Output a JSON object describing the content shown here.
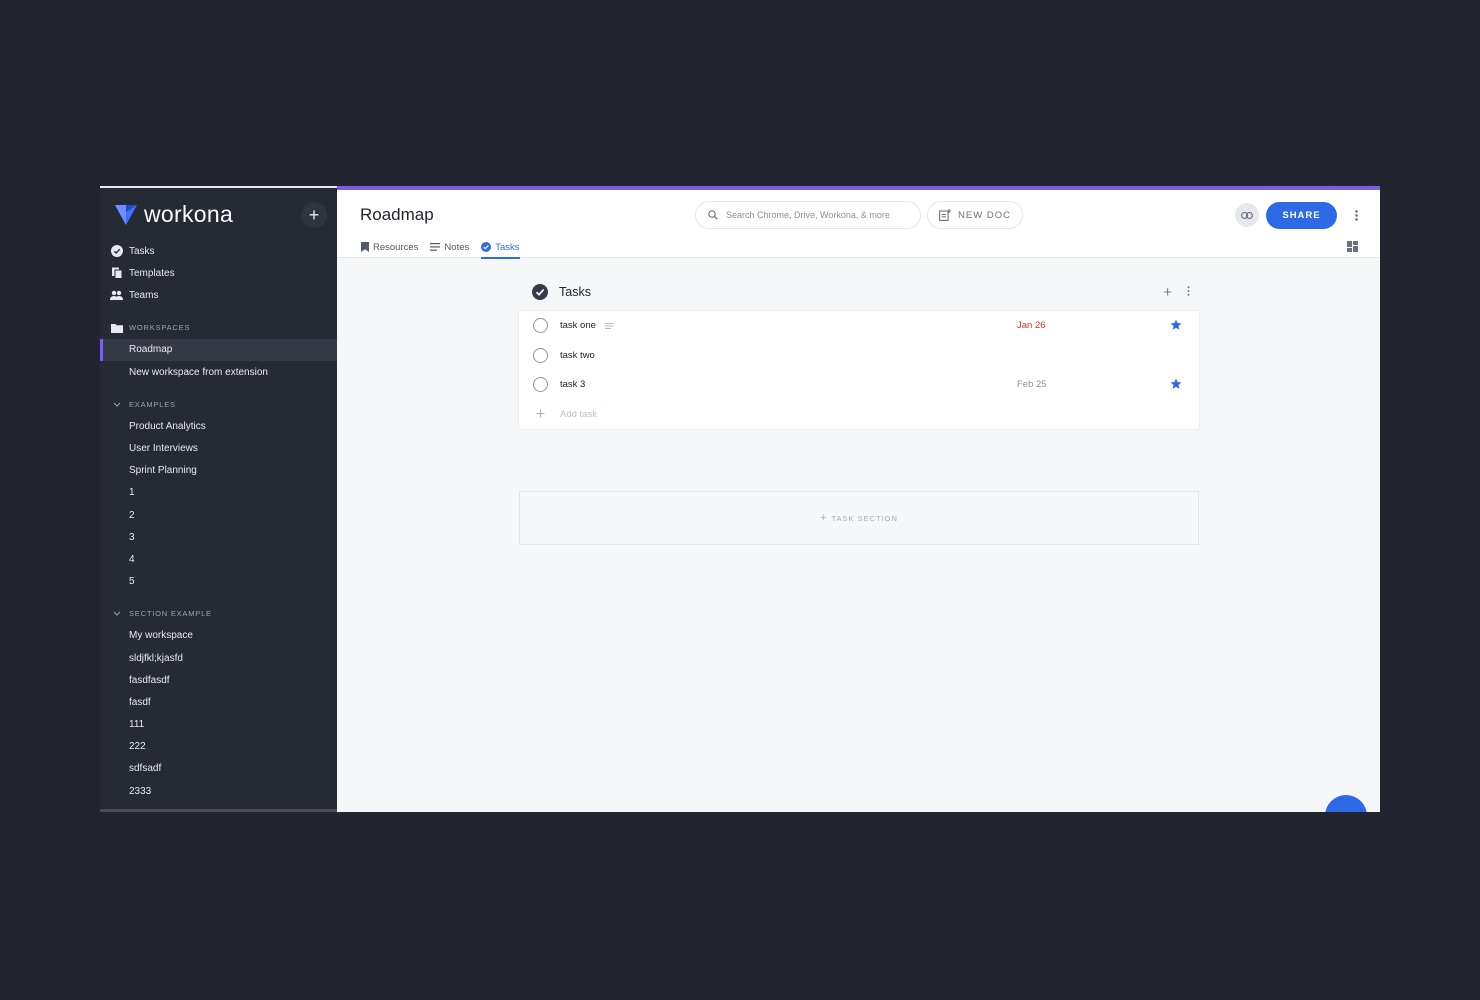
{
  "brand": {
    "name": "workona",
    "accent": "#7b5ce5",
    "primary": "#2f6ae6"
  },
  "sidebar": {
    "add_label": "+",
    "nav": [
      {
        "label": "Tasks",
        "icon": "check-circle-icon"
      },
      {
        "label": "Templates",
        "icon": "copy-icon"
      },
      {
        "label": "Teams",
        "icon": "people-icon"
      }
    ],
    "workspaces": {
      "header": "WORKSPACES",
      "items": [
        "Roadmap",
        "New workspace from extension"
      ]
    },
    "examples": {
      "header": "EXAMPLES",
      "items": [
        "Product Analytics",
        "User Interviews",
        "Sprint Planning",
        "1",
        "2",
        "3",
        "4",
        "5"
      ]
    },
    "section_example": {
      "header": "SECTION EXAMPLE",
      "items": [
        "My workspace",
        "sldjfkl;kjasfd",
        "fasdfasdf",
        "fasdf",
        "111",
        "222",
        "sdfsadf",
        "2333"
      ]
    }
  },
  "header": {
    "title": "Roadmap",
    "tabs": [
      {
        "label": "Resources",
        "icon": "bookmark-icon"
      },
      {
        "label": "Notes",
        "icon": "notes-icon"
      },
      {
        "label": "Tasks",
        "icon": "check-circle-icon"
      }
    ],
    "search_placeholder": "Search Chrome, Drive, Workona, & more",
    "new_doc_label": "NEW DOC",
    "share_label": "SHARE"
  },
  "tasks": {
    "section_title": "Tasks",
    "add_label": "+",
    "items": [
      {
        "name": "task one",
        "due": "Jan 26",
        "due_color": "#d93025",
        "has_notes": true,
        "starred": true
      },
      {
        "name": "task two",
        "due": "",
        "due_color": "#8b90a0",
        "has_notes": false,
        "starred": false
      },
      {
        "name": "task 3",
        "due": "Feb 25",
        "due_color": "#8b90a0",
        "has_notes": false,
        "starred": true
      }
    ],
    "add_task_label": "Add task",
    "add_section_label": "TASK SECTION"
  }
}
